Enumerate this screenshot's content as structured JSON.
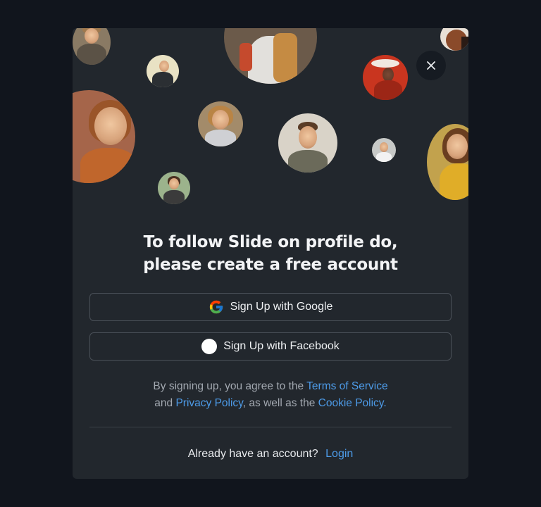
{
  "dialog": {
    "close_icon": "close-icon",
    "title_line1": "To follow Slide on profile do,",
    "title_line2": "please create a free account",
    "google_button_label": "Sign Up with Google",
    "google_icon": "google-icon",
    "facebook_button_label": "Sign Up with Facebook",
    "facebook_icon": "facebook-icon",
    "legal_prefix": "By signing up, you agree to the",
    "terms_link": "Terms of Service",
    "legal_and": "and",
    "privacy_link": "Privacy Policy",
    "legal_mid": ", as well as the",
    "cookie_link": "Cookie Policy.",
    "login_prompt": "Already have an account?",
    "login_link": "Login"
  },
  "colors": {
    "page_background": "#11151d",
    "modal_background": "#22272d",
    "link": "#4d9be8",
    "button_border": "#4a5058"
  }
}
